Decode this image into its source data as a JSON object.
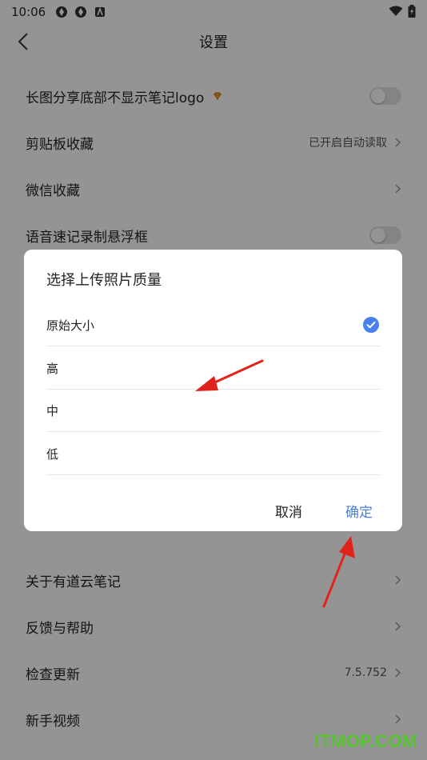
{
  "status_bar": {
    "time": "10:06"
  },
  "header": {
    "title": "设置"
  },
  "settings_group_1": [
    {
      "label": "长图分享底部不显示笔记logo",
      "control": "toggle",
      "on": false,
      "vip": true
    },
    {
      "label": "剪贴板收藏",
      "value": "已开启自动读取",
      "control": "chevron"
    },
    {
      "label": "微信收藏",
      "control": "chevron"
    },
    {
      "label": "语音速记录制悬浮框",
      "control": "toggle",
      "on": false
    }
  ],
  "settings_group_2": [
    {
      "label": "关于有道云笔记",
      "control": "chevron"
    },
    {
      "label": "反馈与帮助",
      "control": "chevron"
    },
    {
      "label": "检查更新",
      "value": "7.5.752",
      "control": "chevron"
    },
    {
      "label": "新手视频",
      "control": "chevron"
    }
  ],
  "dialog": {
    "title": "选择上传照片质量",
    "options": [
      {
        "label": "原始大小",
        "selected": true
      },
      {
        "label": "高",
        "selected": false
      },
      {
        "label": "中",
        "selected": false
      },
      {
        "label": "低",
        "selected": false
      }
    ],
    "cancel_label": "取消",
    "confirm_label": "确定"
  },
  "colors": {
    "accent": "#4a7fd9",
    "check": "#4a80ee",
    "annotation_arrow": "#e0241c",
    "watermark": "#55c22e"
  },
  "watermark": "ITMOP.COM"
}
